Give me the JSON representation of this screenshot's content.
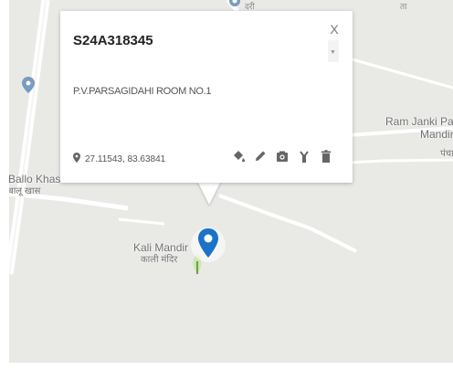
{
  "map": {
    "labels": {
      "top_fragment": "दरी",
      "top_right_fragment": "ता",
      "ballo_khas_en": "Ballo Khas",
      "ballo_khas_hi": "बालू खास",
      "ram_janki_en_1": "Ram Janki Pa",
      "ram_janki_en_2": "Mandir",
      "ram_janki_hi": "पंचा",
      "kali_mandir_en": "Kali Mandir",
      "kali_mandir_hi": "काली मंदिर"
    }
  },
  "popup": {
    "title": "S24A318345",
    "description": "P.V.PARSAGIDAHI ROOM NO.1",
    "coordinates": "27.11543, 83.63841",
    "close_symbol": "X",
    "tools": [
      {
        "name": "paint-bucket-icon"
      },
      {
        "name": "pencil-icon"
      },
      {
        "name": "camera-icon"
      },
      {
        "name": "tool-icon"
      },
      {
        "name": "trash-icon"
      }
    ]
  },
  "colors": {
    "map_background": "#e9e9e6",
    "road": "#ffffff",
    "marker": "#1a73c8",
    "icon_gray": "#666666"
  }
}
